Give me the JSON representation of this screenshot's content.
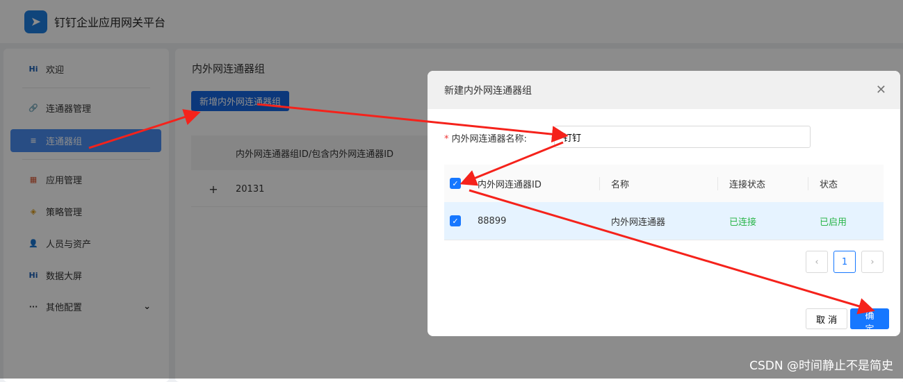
{
  "app": {
    "title": "钉钉企业应用网关平台"
  },
  "sidebar": {
    "items": [
      {
        "label": "欢迎",
        "icon": "Hi"
      },
      {
        "label": "连通器管理",
        "icon": "🔗"
      },
      {
        "label": "连通器组",
        "icon": "≡"
      },
      {
        "label": "应用管理",
        "icon": "▦"
      },
      {
        "label": "策略管理",
        "icon": "◈"
      },
      {
        "label": "人员与资产",
        "icon": "👤"
      },
      {
        "label": "数据大屏",
        "icon": "Hi"
      },
      {
        "label": "其他配置",
        "icon": "···",
        "chevron": "⌄"
      }
    ]
  },
  "main": {
    "title": "内外网连通器组",
    "add_button": "新增内外网连通器组",
    "column": "内外网连通器组ID/包含内外网连通器ID",
    "rows": [
      {
        "expand": "+",
        "id": "20131"
      }
    ]
  },
  "modal": {
    "title": "新建内外网连通器组",
    "close": "✕",
    "field_label": "内外网连通器名称:",
    "required": "*",
    "field_value": "钉钉",
    "columns": [
      "内外网连通器ID",
      "名称",
      "连接状态",
      "状态"
    ],
    "rows": [
      {
        "id": "88899",
        "name": "内外网连通器",
        "conn": "已连接",
        "status": "已启用"
      }
    ],
    "pagination": {
      "prev": "‹",
      "page": "1",
      "next": "›"
    },
    "cancel": "取 消",
    "ok": "确 定"
  },
  "watermark": "CSDN @时间静止不是简史"
}
